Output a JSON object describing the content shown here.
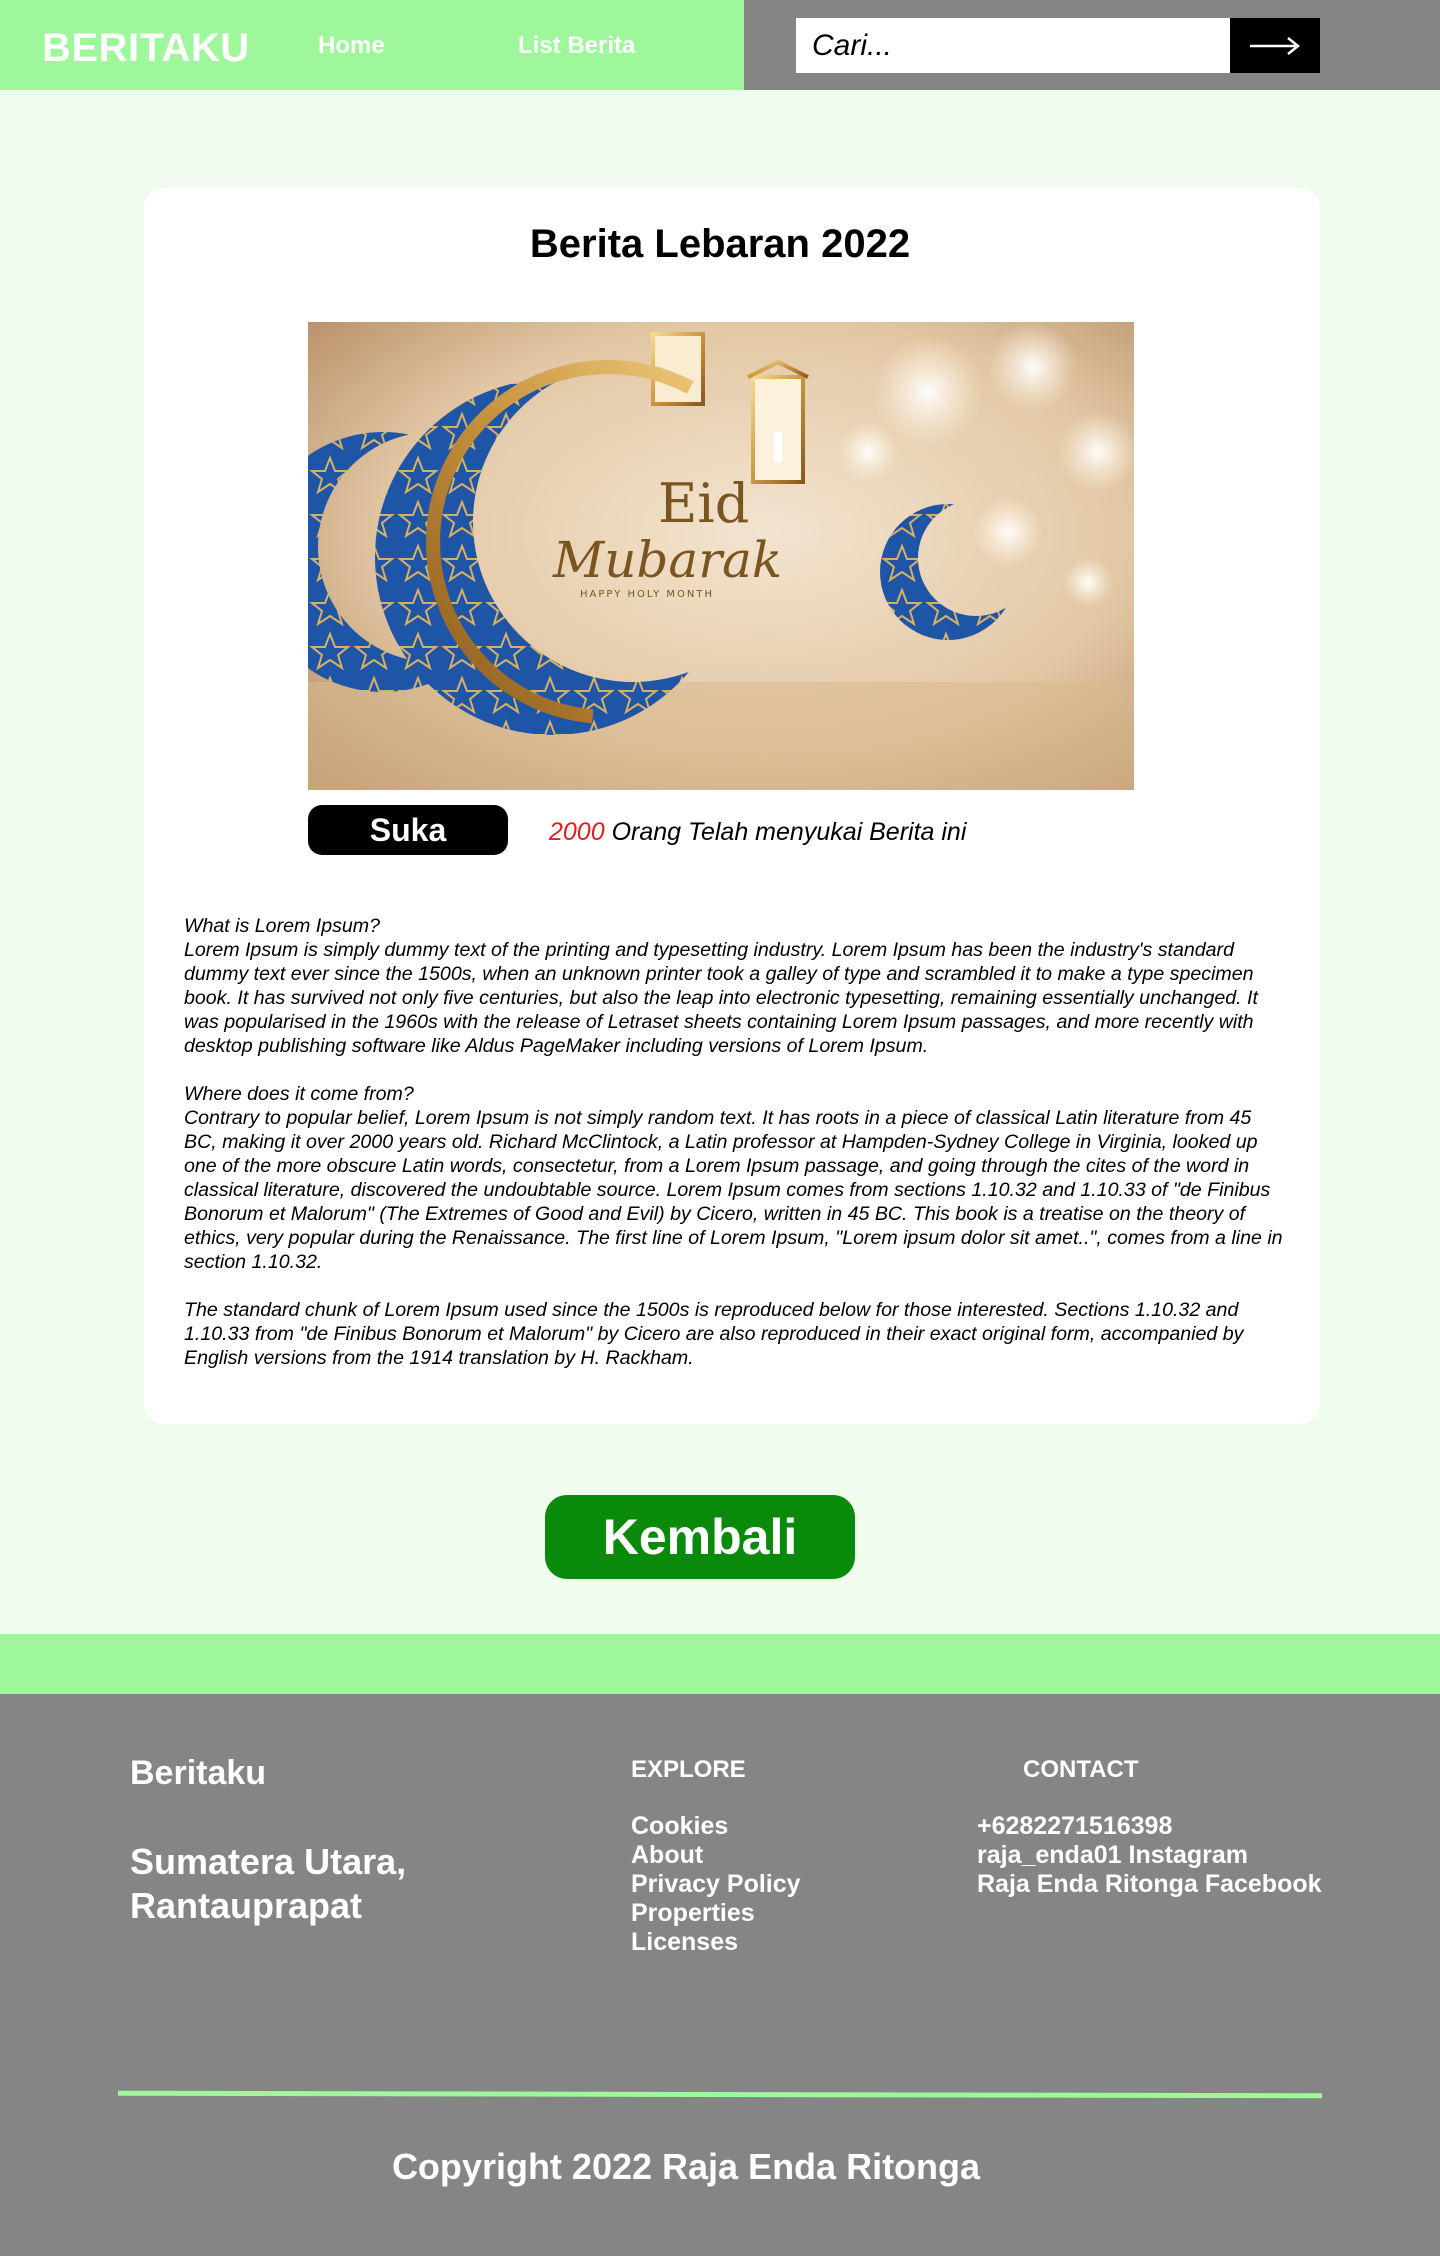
{
  "navbar": {
    "brand": "BERITAKU",
    "links": [
      {
        "label": "Home"
      },
      {
        "label": "List Berita"
      }
    ],
    "search": {
      "placeholder": "Cari..."
    }
  },
  "article": {
    "title": "Berita Lebaran 2022",
    "image_text": {
      "line1": "Eid",
      "line2": "Mubarak",
      "line3": "HAPPY HOLY MONTH"
    },
    "like_button": "Suka",
    "like_count": "2000",
    "like_text": " Orang Telah menyukai Berita ini",
    "paragraphs": [
      "What is Lorem Ipsum?\nLorem Ipsum is simply dummy text of the printing and typesetting industry. Lorem Ipsum has been the industry's standard dummy text ever since the 1500s, when an unknown printer took a galley of type and scrambled it to make a type specimen book. It has survived not only five centuries, but also the leap into electronic typesetting, remaining essentially unchanged. It was popularised in the 1960s with the release of Letraset sheets containing Lorem Ipsum passages, and more recently with desktop publishing software like Aldus PageMaker including versions of Lorem Ipsum.",
      "Where does it come from?\nContrary to popular belief, Lorem Ipsum is not simply random text. It has roots in a piece of classical Latin literature from 45 BC, making it over 2000 years old. Richard McClintock, a Latin professor at Hampden-Sydney College in Virginia, looked up one of the more obscure Latin words, consectetur, from a Lorem Ipsum passage, and going through the cites of the word in classical literature, discovered the undoubtable source. Lorem Ipsum comes from sections 1.10.32 and 1.10.33 of \"de Finibus Bonorum et Malorum\" (The Extremes of Good and Evil) by Cicero, written in 45 BC. This book is a treatise on the theory of ethics, very popular during the Renaissance. The first line of Lorem Ipsum, \"Lorem ipsum dolor sit amet..\", comes from a line in section 1.10.32.",
      "The standard chunk of Lorem Ipsum used since the 1500s is reproduced below for those interested. Sections 1.10.32 and 1.10.33 from \"de Finibus Bonorum et Malorum\" by Cicero are also reproduced in their exact original form, accompanied by English versions from the 1914 translation by H. Rackham."
    ]
  },
  "back_button": "Kembali",
  "footer": {
    "brand": "Beritaku",
    "address": "Sumatera Utara, Rantauprapat",
    "explore": {
      "heading": "EXPLORE",
      "items": [
        "Cookies",
        "About",
        "Privacy Policy",
        "Properties",
        "Licenses"
      ]
    },
    "contact": {
      "heading": "CONTACT",
      "phone": "+6282271516398",
      "instagram_handle": "raja_enda01",
      "instagram_label": "Instagram",
      "facebook_name": "Raja Enda Ritonga",
      "facebook_label": "Facebook"
    },
    "copyright": "Copyright 2022 Raja Enda Ritonga"
  },
  "colors": {
    "nav_green": "#9ef79a",
    "gray": "#858585",
    "page_bg": "#f0fdee",
    "back_button": "#0a8a0a",
    "like_count": "#e02020"
  },
  "icons": {
    "search_button": "arrow-right-icon"
  }
}
